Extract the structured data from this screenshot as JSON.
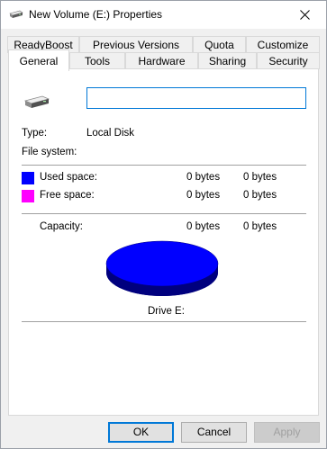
{
  "window": {
    "title": "New Volume (E:) Properties"
  },
  "tabs_row1": [
    "ReadyBoost",
    "Previous Versions",
    "Quota",
    "Customize"
  ],
  "tabs_row2": [
    "General",
    "Tools",
    "Hardware",
    "Sharing",
    "Security"
  ],
  "general": {
    "name_value": "",
    "type_label": "Type:",
    "type_value": "Local Disk",
    "filesystem_label": "File system:",
    "filesystem_value": "",
    "used_label": "Used space:",
    "used_bytes": "0 bytes",
    "used_size": "0 bytes",
    "free_label": "Free space:",
    "free_bytes": "0 bytes",
    "free_size": "0 bytes",
    "capacity_label": "Capacity:",
    "capacity_bytes": "0 bytes",
    "capacity_size": "0 bytes",
    "drive_label": "Drive E:",
    "used_color": "#0000ff",
    "free_color": "#ff00ff"
  },
  "buttons": {
    "ok": "OK",
    "cancel": "Cancel",
    "apply": "Apply"
  }
}
